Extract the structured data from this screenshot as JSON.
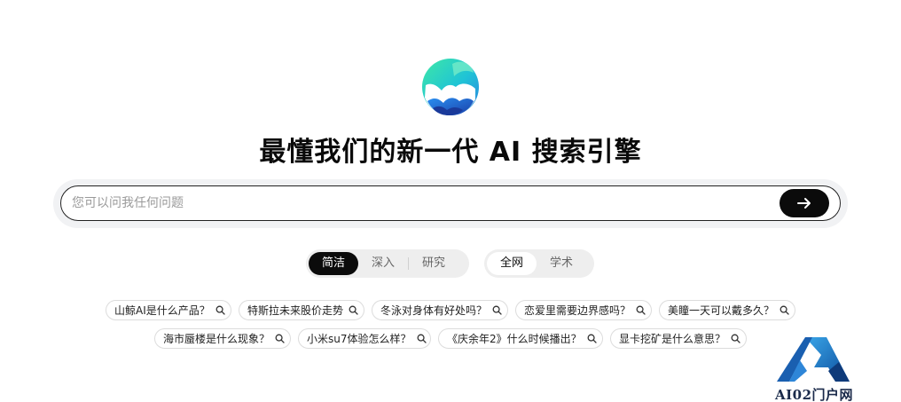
{
  "headline": "最懂我们的新一代 AI 搜索引擎",
  "search": {
    "placeholder": "您可以问我任何问题",
    "value": ""
  },
  "modes": [
    {
      "label": "简洁",
      "active": true
    },
    {
      "label": "深入",
      "active": false
    },
    {
      "label": "研究",
      "active": false
    }
  ],
  "scopes": [
    {
      "label": "全网",
      "active": true
    },
    {
      "label": "学术",
      "active": false
    }
  ],
  "suggestions": [
    "山鲸AI是什么产品？",
    "特斯拉未来股价走势",
    "冬泳对身体有好处吗？",
    "恋爱里需要边界感吗？",
    "美瞳一天可以戴多久？",
    "海市蜃楼是什么现象？",
    "小米su7体验怎么样？",
    "《庆余年2》什么时候播出？",
    "显卡挖矿是什么意思？"
  ],
  "watermark": {
    "text": "AI02门户网"
  },
  "colors": {
    "accent": "#0b0b0b",
    "chip_border": "#dcdcdc",
    "search_bg": "#f1f2f4"
  },
  "icons": {
    "send": "arrow-right-icon",
    "suggestion": "search-icon",
    "logo": "whale-wave-logo"
  }
}
